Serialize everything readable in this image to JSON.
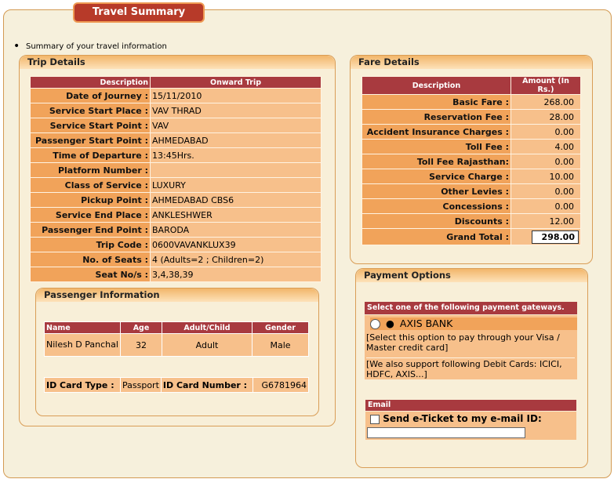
{
  "title": "Travel Summary",
  "summary_text": "Summary of your travel information",
  "trip": {
    "heading": "Trip Details",
    "col_desc": "Description",
    "col_trip": "Onward Trip",
    "rows": [
      {
        "label": "Date of Journey :",
        "value": "15/11/2010"
      },
      {
        "label": "Service Start Place :",
        "value": "VAV THRAD"
      },
      {
        "label": "Service Start Point :",
        "value": "VAV"
      },
      {
        "label": "Passenger Start Point :",
        "value": "AHMEDABAD"
      },
      {
        "label": "Time of Departure :",
        "value": "13:45Hrs."
      },
      {
        "label": "Platform Number :",
        "value": ""
      },
      {
        "label": "Class of Service :",
        "value": "LUXURY"
      },
      {
        "label": "Pickup Point :",
        "value": "AHMEDABAD CBS6"
      },
      {
        "label": "Service End Place :",
        "value": "ANKLESHWER"
      },
      {
        "label": "Passenger End Point :",
        "value": "BARODA"
      },
      {
        "label": "Trip Code :",
        "value": "0600VAVANKLUX39"
      },
      {
        "label": "No. of Seats :",
        "value": "4 (Adults=2 ; Children=2)"
      },
      {
        "label": "Seat No/s :",
        "value": "3,4,38,39"
      }
    ]
  },
  "passenger": {
    "heading": "Passenger Information",
    "cols": [
      "Name",
      "Age",
      "Adult/Child",
      "Gender"
    ],
    "row": {
      "name": "Nilesh D Panchal",
      "age": "32",
      "type": "Adult",
      "gender": "Male"
    },
    "id_type_label": "ID Card Type :",
    "id_type": "Passport",
    "id_number_label": "ID Card Number :",
    "id_number": "G6781964"
  },
  "fare": {
    "heading": "Fare Details",
    "col_desc": "Description",
    "col_amount": "Amount (In Rs.)",
    "rows": [
      {
        "label": "Basic Fare :",
        "value": "268.00"
      },
      {
        "label": "Reservation Fee :",
        "value": "28.00"
      },
      {
        "label": "Accident Insurance Charges :",
        "value": "0.00"
      },
      {
        "label": "Toll Fee :",
        "value": "4.00"
      },
      {
        "label": "Toll Fee Rajasthan:",
        "value": "0.00"
      },
      {
        "label": "Service Charge :",
        "value": "10.00"
      },
      {
        "label": "Other Levies :",
        "value": "0.00"
      },
      {
        "label": "Concessions :",
        "value": "0.00"
      },
      {
        "label": "Discounts :",
        "value": "12.00"
      }
    ],
    "grand_label": "Grand Total :",
    "grand_value": "298.00"
  },
  "payment": {
    "heading": "Payment Options",
    "bar_text": "Select one of the following payment gateways.",
    "bank": "AXIS BANK",
    "note1": "[Select this option to pay through your Visa / Master credit card]",
    "note2": "[We also support following Debit Cards: ICICI, HDFC, AXIS...]",
    "email_bar": "Email",
    "email_label": "Send e-Ticket to my e-mail ID:",
    "email_value": ""
  },
  "colors": {
    "header_red": "#a83a3f",
    "label_orange": "#f1a35a",
    "value_peach": "#f7c08b",
    "panel_bg": "#f8efd8"
  }
}
